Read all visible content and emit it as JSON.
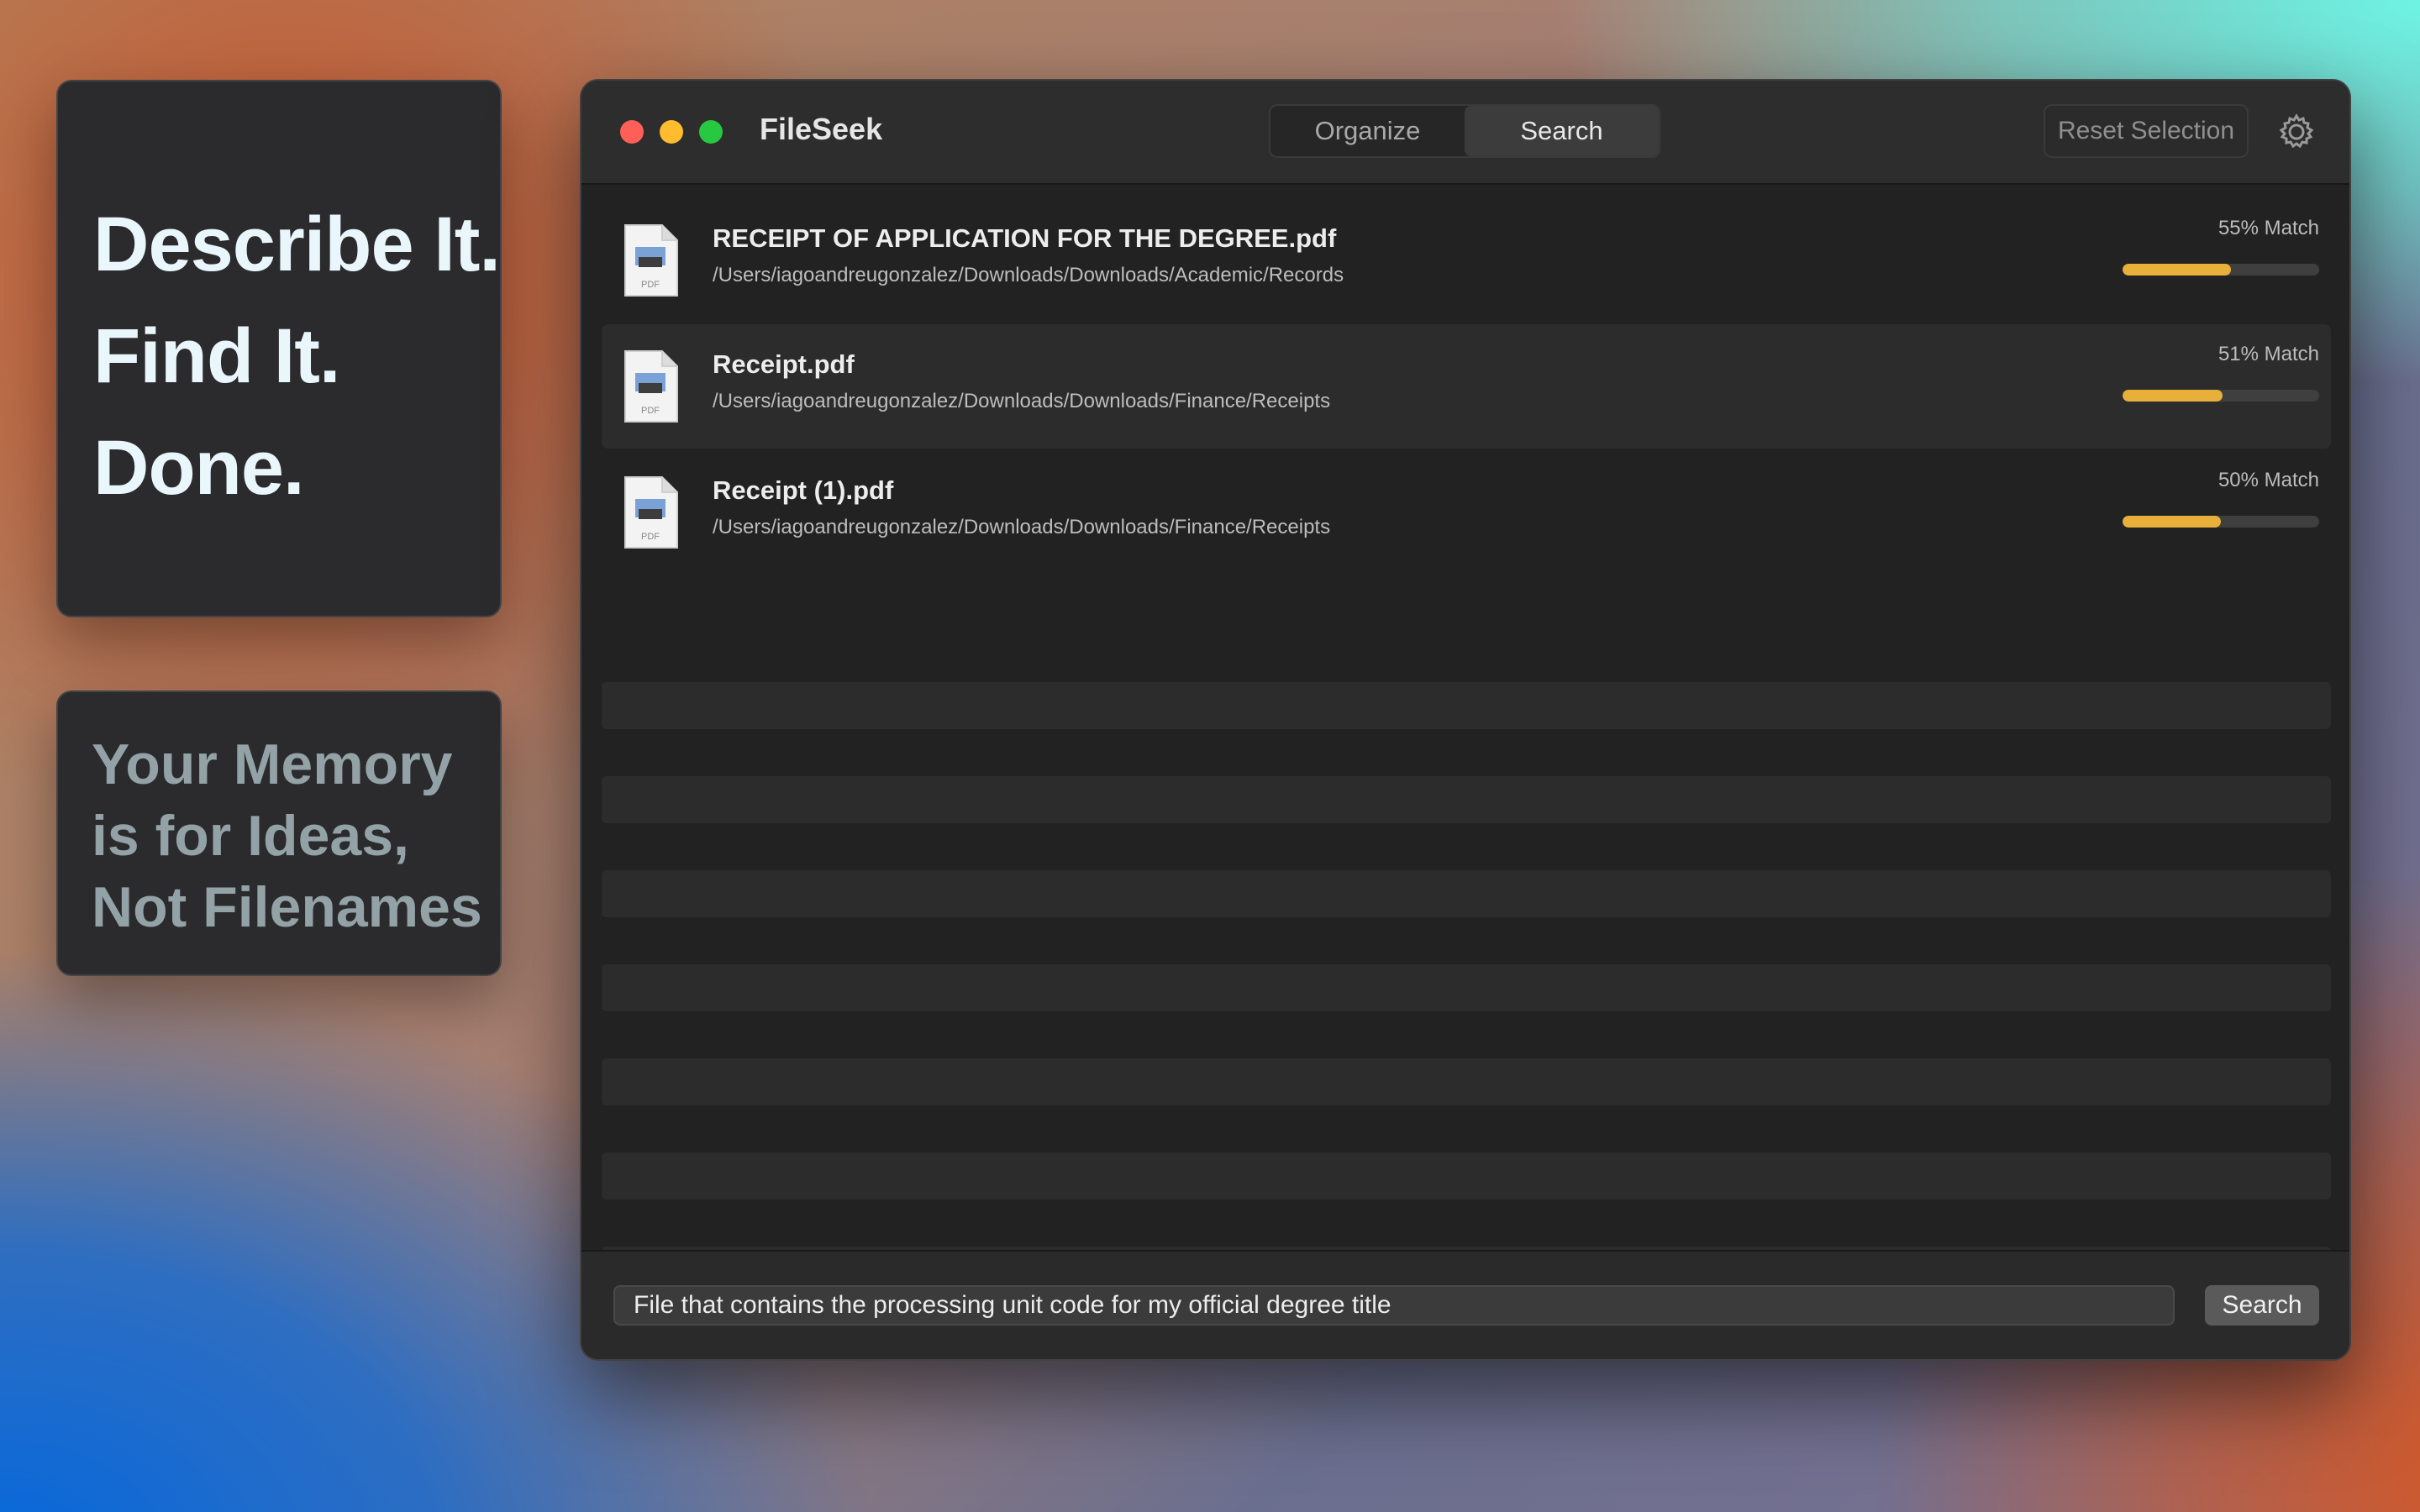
{
  "promo": {
    "headline": [
      "Describe It.",
      "Find It.",
      "Done."
    ],
    "tagline": [
      "Your Memory",
      "is for Ideas,",
      "Not Filenames"
    ]
  },
  "window": {
    "title": "FileSeek",
    "tabs": [
      {
        "label": "Organize",
        "active": false
      },
      {
        "label": "Search",
        "active": true
      }
    ],
    "reset_label": "Reset Selection",
    "settings_icon": "gear-icon"
  },
  "results": [
    {
      "name": "RECEIPT OF APPLICATION FOR THE DEGREE.pdf",
      "path": "/Users/iagoandreugonzalez/Downloads/Downloads/Academic/Records",
      "match_label": "55% Match",
      "match": 0.55,
      "icon": "pdf-file-icon"
    },
    {
      "name": "Receipt.pdf",
      "path": "/Users/iagoandreugonzalez/Downloads/Downloads/Finance/Receipts",
      "match_label": "51% Match",
      "match": 0.51,
      "icon": "pdf-file-icon"
    },
    {
      "name": "Receipt (1).pdf",
      "path": "/Users/iagoandreugonzalez/Downloads/Downloads/Finance/Receipts",
      "match_label": "50% Match",
      "match": 0.5,
      "icon": "pdf-file-icon"
    }
  ],
  "search": {
    "query": "File that contains the processing unit code for my official degree title",
    "button_label": "Search"
  },
  "colors": {
    "accent_match": "#e8b03b",
    "window_bg": "#222222",
    "close": "#ff5f57",
    "minimize": "#febc2e",
    "maximize": "#28c840"
  }
}
